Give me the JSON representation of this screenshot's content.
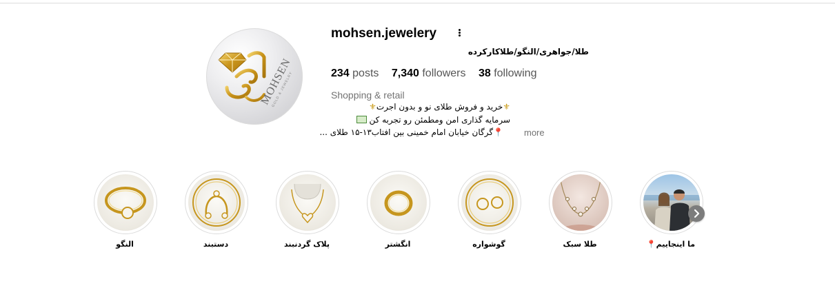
{
  "profile": {
    "username": "mohsen.jewelery",
    "full_name": "طلا/جواهری/النگو/طلاکارکرده",
    "category": "Shopping & retail",
    "bio_lines": [
      "خرید و فروش طلای نو و بدون اجرت",
      "سرمایه گذاری امن ومطمئن رو تجربه کن",
      "گرگان خیابان امام خمینی بین افتاب۱۳-۱۵ طلای ..."
    ],
    "more_label": "more",
    "avatar_logo_text": "MOHSEN",
    "avatar_logo_subtext": "GOLD & JEWELRY"
  },
  "stats": {
    "posts_count": "234",
    "posts_label": "posts",
    "followers_count": "7,340",
    "followers_label": "followers",
    "following_count": "38",
    "following_label": "following"
  },
  "highlights": [
    {
      "label": "النگو",
      "icon": "bangle-icon"
    },
    {
      "label": "دستبند",
      "icon": "bracelet-icon"
    },
    {
      "label": "پلاک گردنبند",
      "icon": "necklace-pendant-icon"
    },
    {
      "label": "انگشتر",
      "icon": "ring-icon"
    },
    {
      "label": "گوشواره",
      "icon": "earrings-icon"
    },
    {
      "label": "طلا سبک",
      "icon": "light-gold-chain-icon"
    },
    {
      "label": "ما اینجاییم",
      "icon": "couple-photo-icon"
    }
  ],
  "icons": {
    "options": "more-options-icon",
    "next": "chevron-right-icon",
    "fleur": "fleur-de-lis-icon",
    "pin": "location-pin-icon",
    "money": "banknote-icon"
  },
  "colors": {
    "gold": "#c99a16",
    "secondary_text": "#737373",
    "border": "#dbdbdb"
  }
}
